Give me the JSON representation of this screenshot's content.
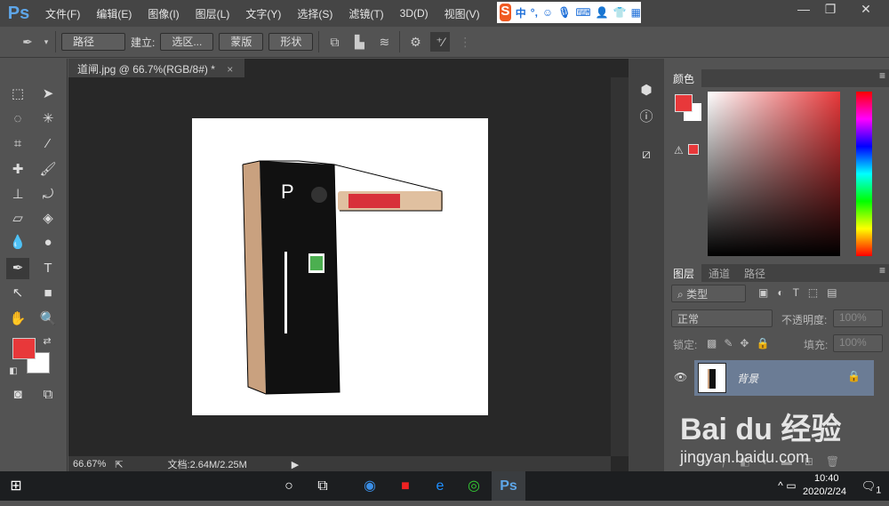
{
  "app": {
    "logo": "Ps"
  },
  "menu": [
    "文件(F)",
    "编辑(E)",
    "图像(I)",
    "图层(L)",
    "文字(Y)",
    "选择(S)",
    "滤镜(T)",
    "3D(D)",
    "视图(V)"
  ],
  "ime": {
    "logo": "S",
    "mode": "中",
    "punct": "°,"
  },
  "window_controls": {
    "minimize": "—",
    "restore": "❐",
    "close": "✕"
  },
  "options": {
    "mode": "路径",
    "make_label": "建立:",
    "selection": "选区...",
    "mask": "蒙版",
    "shape": "形状"
  },
  "document": {
    "tab": "道闸.jpg @ 66.7%(RGB/8#) *",
    "tab_close": "×",
    "zoom": "66.67%",
    "doc_info": "文档:2.64M/2.25M"
  },
  "color_panel": {
    "tab": "颜色",
    "fg": "#e8383a",
    "bg": "#ffffff"
  },
  "layers_panel": {
    "tabs": [
      "图层",
      "通道",
      "路径"
    ],
    "filter": "类型",
    "blend": "正常",
    "opacity_label": "不透明度:",
    "opacity": "100%",
    "lock_label": "锁定:",
    "fill_label": "填充:",
    "fill": "100%",
    "layers": [
      {
        "name": "背景",
        "visible": true,
        "locked": true
      }
    ]
  },
  "taskbar": {
    "time": "10:40",
    "date": "2020/2/24",
    "notifications": "1"
  },
  "watermark": {
    "brand": "Bai du 经验",
    "url": "jingyan.baidu.com"
  }
}
